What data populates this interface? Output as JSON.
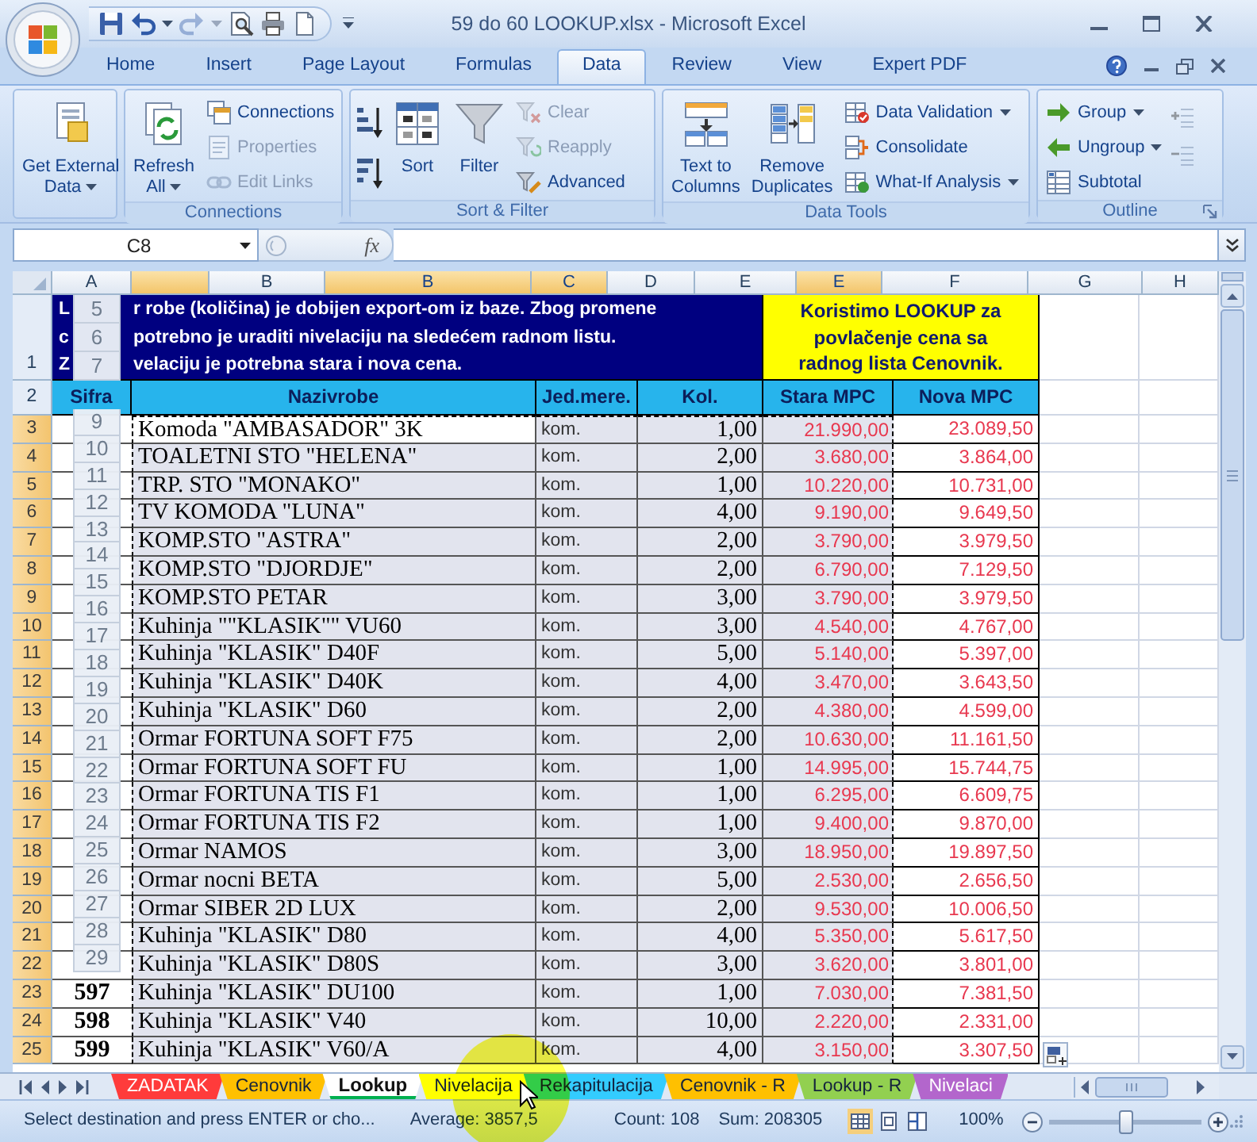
{
  "window": {
    "title": "59 do 60 LOOKUP.xlsx - Microsoft Excel"
  },
  "quick_access": [
    {
      "disabled": false,
      "dropdown": false
    },
    {
      "disabled": false,
      "dropdown": true
    },
    {
      "disabled": true,
      "dropdown": true
    },
    {
      "disabled": false,
      "dropdown": false
    },
    {
      "disabled": false,
      "dropdown": false
    },
    {
      "disabled": false,
      "dropdown": false
    }
  ],
  "ribbon": {
    "tabs": [
      {
        "label": "Home",
        "selected": false
      },
      {
        "label": "Insert",
        "selected": false
      },
      {
        "label": "Page Layout",
        "selected": false
      },
      {
        "label": "Formulas",
        "selected": false
      },
      {
        "label": "Data",
        "selected": true
      },
      {
        "label": "Review",
        "selected": false
      },
      {
        "label": "View",
        "selected": false
      },
      {
        "label": "Expert PDF",
        "selected": false
      }
    ],
    "groups": [
      {
        "dialog_launcher": false,
        "items": [
          {
            "kind": "large",
            "lines": [
              "Get External",
              "Data"
            ],
            "disabled": false,
            "dropdown": true
          }
        ]
      },
      {
        "label": "Connections",
        "dialog_launcher": false,
        "items": [
          {
            "kind": "large",
            "lines": [
              "Refresh",
              "All"
            ],
            "disabled": false,
            "dropdown": true
          },
          {
            "kind": "small",
            "label": "Connections",
            "disabled": false,
            "dropdown": false
          },
          {
            "kind": "small",
            "label": "Properties",
            "disabled": true,
            "dropdown": false
          },
          {
            "kind": "small",
            "label": "Edit Links",
            "disabled": true,
            "dropdown": false
          }
        ]
      },
      {
        "label": "Sort & Filter",
        "dialog_launcher": false,
        "items": [
          {
            "kind": "icon",
            "disabled": false,
            "dropdown": false
          },
          {
            "kind": "icon",
            "disabled": false,
            "dropdown": false
          },
          {
            "kind": "large",
            "lines": [
              "Sort"
            ],
            "disabled": false,
            "dropdown": false
          },
          {
            "kind": "large",
            "lines": [
              "Filter"
            ],
            "disabled": false,
            "dropdown": false
          },
          {
            "kind": "small",
            "label": "Clear",
            "disabled": true,
            "dropdown": false
          },
          {
            "kind": "small",
            "label": "Reapply",
            "disabled": true,
            "dropdown": false
          },
          {
            "kind": "small",
            "label": "Advanced",
            "disabled": false,
            "dropdown": false
          }
        ]
      },
      {
        "label": "Data Tools",
        "dialog_launcher": false,
        "items": [
          {
            "kind": "large",
            "lines": [
              "Text to",
              "Columns"
            ],
            "disabled": false,
            "dropdown": false
          },
          {
            "kind": "large",
            "lines": [
              "Remove",
              "Duplicates"
            ],
            "disabled": false,
            "dropdown": false
          },
          {
            "kind": "small",
            "label": "Data Validation",
            "disabled": false,
            "dropdown": true
          },
          {
            "kind": "small",
            "label": "Consolidate",
            "disabled": false,
            "dropdown": false
          },
          {
            "kind": "small",
            "label": "What-If Analysis",
            "disabled": false,
            "dropdown": true
          }
        ]
      },
      {
        "label": "Outline",
        "dialog_launcher": true,
        "items": [
          {
            "kind": "small",
            "label": "Group",
            "disabled": false,
            "dropdown": true
          },
          {
            "kind": "small",
            "label": "Ungroup",
            "disabled": false,
            "dropdown": true
          },
          {
            "kind": "small",
            "label": "Subtotal",
            "disabled": false,
            "dropdown": false
          },
          {
            "kind": "icon",
            "disabled": true,
            "dropdown": false
          },
          {
            "kind": "icon",
            "disabled": true,
            "dropdown": false
          }
        ]
      }
    ]
  },
  "formula_bar": {
    "name_box": "C8",
    "function_label": "fx"
  },
  "sheet": {
    "column_headers": [
      {
        "label": "A",
        "selected": false
      },
      {
        "selected": true
      },
      {
        "label": "B",
        "selected": false
      },
      {
        "label": "B",
        "selected": true
      },
      {
        "label": "C",
        "selected": true
      },
      {
        "label": "D",
        "selected": false
      },
      {
        "label": "E",
        "selected": false
      },
      {
        "label": "E",
        "selected": true
      },
      {
        "label": "F",
        "selected": false
      },
      {
        "label": "G",
        "selected": false
      },
      {
        "label": "H",
        "selected": false
      }
    ],
    "banner": {
      "row": "1",
      "selected": false,
      "lines": [
        {
          "lead": "L",
          "rest": "r robe (količina) je dobijen export-om iz baze. Zbog promene"
        },
        {
          "lead": "c",
          "rest": "potrebno je uraditi nivelaciju na sledećem radnom listu."
        },
        {
          "lead": "Z",
          "rest": "velaciju je potrebna stara i nova cena."
        }
      ],
      "note": "Koristimo LOOKUP za povlačenje cena sa radnog lista Cenovnik."
    },
    "header": {
      "row": "2",
      "selected": false,
      "cells": [
        "Sifra",
        "Nazivrobe",
        "Jed.mere.",
        "Kol.",
        "Stara MPC",
        "Nova MPC"
      ]
    },
    "rows": [
      {
        "row": "3",
        "selected": true,
        "active": true,
        "name": "Komoda \"AMBASADOR\" 3K",
        "unit": "kom.",
        "qty": "1,00",
        "old_price": "21.990,00",
        "new_price": "23.089,50"
      },
      {
        "row": "4",
        "selected": true,
        "active": false,
        "name": "TOALETNI STO \"HELENA\"",
        "unit": "kom.",
        "qty": "2,00",
        "old_price": "3.680,00",
        "new_price": "3.864,00"
      },
      {
        "row": "5",
        "selected": true,
        "active": false,
        "name": "TRP. STO \"MONAKO\"",
        "unit": "kom.",
        "qty": "1,00",
        "old_price": "10.220,00",
        "new_price": "10.731,00"
      },
      {
        "row": "6",
        "selected": true,
        "active": false,
        "name": "TV KOMODA \"LUNA\"",
        "unit": "kom.",
        "qty": "4,00",
        "old_price": "9.190,00",
        "new_price": "9.649,50"
      },
      {
        "row": "7",
        "selected": true,
        "active": false,
        "name": "KOMP.STO \"ASTRA\"",
        "unit": "kom.",
        "qty": "2,00",
        "old_price": "3.790,00",
        "new_price": "3.979,50"
      },
      {
        "row": "8",
        "selected": true,
        "active": false,
        "name": "KOMP.STO \"DJORDJE\"",
        "unit": "kom.",
        "qty": "2,00",
        "old_price": "6.790,00",
        "new_price": "7.129,50"
      },
      {
        "row": "9",
        "selected": true,
        "active": false,
        "name": "KOMP.STO PETAR",
        "unit": "kom.",
        "qty": "3,00",
        "old_price": "3.790,00",
        "new_price": "3.979,50"
      },
      {
        "row": "10",
        "selected": true,
        "active": false,
        "name": "Kuhinja \"\"KLASIK\"\" VU60",
        "unit": "kom.",
        "qty": "3,00",
        "old_price": "4.540,00",
        "new_price": "4.767,00"
      },
      {
        "row": "11",
        "selected": true,
        "active": false,
        "name": "Kuhinja \"KLASIK\" D40F",
        "unit": "kom.",
        "qty": "5,00",
        "old_price": "5.140,00",
        "new_price": "5.397,00"
      },
      {
        "row": "12",
        "selected": true,
        "active": false,
        "name": "Kuhinja \"KLASIK\" D40K",
        "unit": "kom.",
        "qty": "4,00",
        "old_price": "3.470,00",
        "new_price": "3.643,50"
      },
      {
        "row": "13",
        "selected": true,
        "active": false,
        "name": "Kuhinja \"KLASIK\" D60",
        "unit": "kom.",
        "qty": "2,00",
        "old_price": "4.380,00",
        "new_price": "4.599,00"
      },
      {
        "row": "14",
        "selected": true,
        "active": false,
        "name": "Ormar FORTUNA SOFT F75",
        "unit": "kom.",
        "qty": "2,00",
        "old_price": "10.630,00",
        "new_price": "11.161,50"
      },
      {
        "row": "15",
        "selected": true,
        "active": false,
        "name": "Ormar FORTUNA SOFT FU",
        "unit": "kom.",
        "qty": "1,00",
        "old_price": "14.995,00",
        "new_price": "15.744,75"
      },
      {
        "row": "16",
        "selected": true,
        "active": false,
        "name": "Ormar FORTUNA TIS F1",
        "unit": "kom.",
        "qty": "1,00",
        "old_price": "6.295,00",
        "new_price": "6.609,75"
      },
      {
        "row": "17",
        "selected": true,
        "active": false,
        "name": "Ormar FORTUNA TIS F2",
        "unit": "kom.",
        "qty": "1,00",
        "old_price": "9.400,00",
        "new_price": "9.870,00"
      },
      {
        "row": "18",
        "selected": true,
        "active": false,
        "name": "Ormar NAMOS",
        "unit": "kom.",
        "qty": "3,00",
        "old_price": "18.950,00",
        "new_price": "19.897,50"
      },
      {
        "row": "19",
        "selected": true,
        "active": false,
        "name": "Ormar nocni BETA",
        "unit": "kom.",
        "qty": "5,00",
        "old_price": "2.530,00",
        "new_price": "2.656,50"
      },
      {
        "row": "20",
        "selected": true,
        "active": false,
        "name": "Ormar SIBER 2D LUX",
        "unit": "kom.",
        "qty": "2,00",
        "old_price": "9.530,00",
        "new_price": "10.006,50"
      },
      {
        "row": "21",
        "selected": true,
        "active": false,
        "name": "Kuhinja \"KLASIK\" D80",
        "unit": "kom.",
        "qty": "4,00",
        "old_price": "5.350,00",
        "new_price": "5.617,50"
      },
      {
        "row": "22",
        "selected": true,
        "active": false,
        "name": "Kuhinja \"KLASIK\" D80S",
        "unit": "kom.",
        "qty": "3,00",
        "old_price": "3.620,00",
        "new_price": "3.801,00"
      },
      {
        "row": "23",
        "selected": true,
        "active": false,
        "code": "597",
        "name": "Kuhinja \"KLASIK\" DU100",
        "unit": "kom.",
        "qty": "1,00",
        "old_price": "7.030,00",
        "new_price": "7.381,50"
      },
      {
        "row": "24",
        "selected": true,
        "active": false,
        "code": "598",
        "name": "Kuhinja \"KLASIK\" V40",
        "unit": "kom.",
        "qty": "10,00",
        "old_price": "2.220,00",
        "new_price": "2.331,00"
      },
      {
        "row": "25",
        "selected": true,
        "active": false,
        "code": "599",
        "name": "Kuhinja \"KLASIK\" V60/A",
        "unit": "kom.",
        "qty": "4,00",
        "old_price": "3.150,00",
        "new_price": "3.307,50"
      }
    ],
    "dragged_row_headers": {
      "upper": [
        "5",
        "6",
        "7"
      ],
      "lower": [
        "9",
        "10",
        "11",
        "12",
        "13",
        "14",
        "15",
        "16",
        "17",
        "18",
        "19",
        "20",
        "21",
        "22",
        "23",
        "24",
        "25",
        "26",
        "27",
        "28",
        "29"
      ]
    }
  },
  "sheet_tabs": [
    {
      "label": "ZADATAK",
      "selected": false,
      "color": "#ff3b3b"
    },
    {
      "label": "Cenovnik",
      "selected": false,
      "color": "#ffc000"
    },
    {
      "label": "Lookup",
      "selected": true,
      "color": "#00b050"
    },
    {
      "label": "Nivelacija",
      "selected": false,
      "color": "#ffff00"
    },
    {
      "label": "Rekapitulacija",
      "selected": false,
      "color": "#33ccff"
    },
    {
      "label": "Cenovnik - R",
      "selected": false,
      "color": "#ffc000"
    },
    {
      "label": "Lookup - R",
      "selected": false,
      "color": "#92d050"
    },
    {
      "label": "Nivelaci",
      "selected": false,
      "color": "#b366cc"
    }
  ],
  "status_bar": {
    "message": "Select destination and press ENTER or cho...",
    "average": "Average: 3857,5",
    "count": "Count: 108",
    "sum": "Sum: 208305",
    "views": [
      {
        "kind": "normal",
        "selected": true
      },
      {
        "kind": "layout",
        "selected": false
      },
      {
        "kind": "break",
        "selected": false
      }
    ],
    "zoom": "100%",
    "zoom_slider": {
      "level": 0.5
    }
  }
}
